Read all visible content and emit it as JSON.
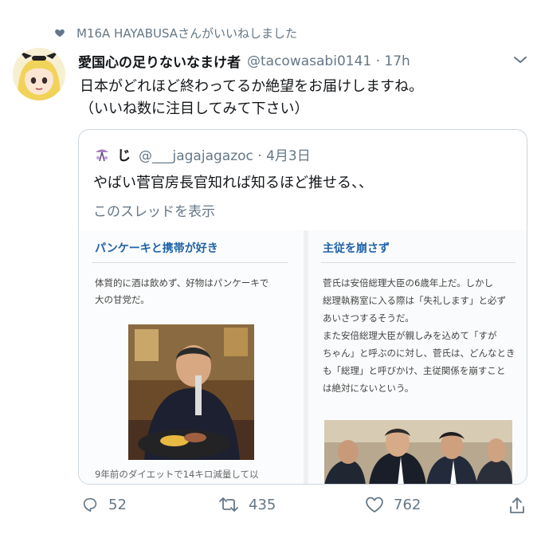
{
  "liked_by": {
    "text": "M16A  HAYABUSAさんがいいねしました"
  },
  "tweet": {
    "author_name": "愛国心の足りないなまけ者",
    "handle_time": "@tacowasabi0141 · 17h",
    "lines": [
      "日本がどれほど終わってるか絶望をお届けしますね。",
      "（いいね数に注目してみて下さい）"
    ]
  },
  "quoted": {
    "name": "じ",
    "handle_date": "@___jagajagazoc · 4月3日",
    "text": "やばい菅官房長官知れば知るほど推せる、、",
    "thread_link": "このスレッドを表示",
    "left_panel": {
      "heading": "パンケーキと携帯が好き",
      "body": [
        "体質的に酒は飲めず、好物はパンケーキで",
        "大の甘党だ。"
      ],
      "caption": "9年前のダイエットで14キロ減量して以"
    },
    "right_panel": {
      "heading": "主従を崩さず",
      "body": [
        "菅氏は安倍総理大臣の6歳年上だ。しかし",
        "総理執務室に入る際は「失礼します」と必ず",
        "あいさつするそうだ。",
        "また安倍総理大臣が親しみを込めて「すが",
        "ちゃん」と呼ぶのに対し、菅氏は、どんなとき",
        "も「総理」と呼びかけ、主従関係を崩すこと",
        "は絶対にないという。"
      ]
    }
  },
  "actions": {
    "replies": "52",
    "retweets": "435",
    "likes": "762"
  },
  "colors": {
    "secondary": "#657786",
    "heading_blue": "#1f62a8",
    "border": "#ccd6dd"
  },
  "icons": [
    "heart-icon",
    "chevron-down-icon",
    "reply-icon",
    "retweet-icon",
    "like-icon",
    "share-icon"
  ]
}
